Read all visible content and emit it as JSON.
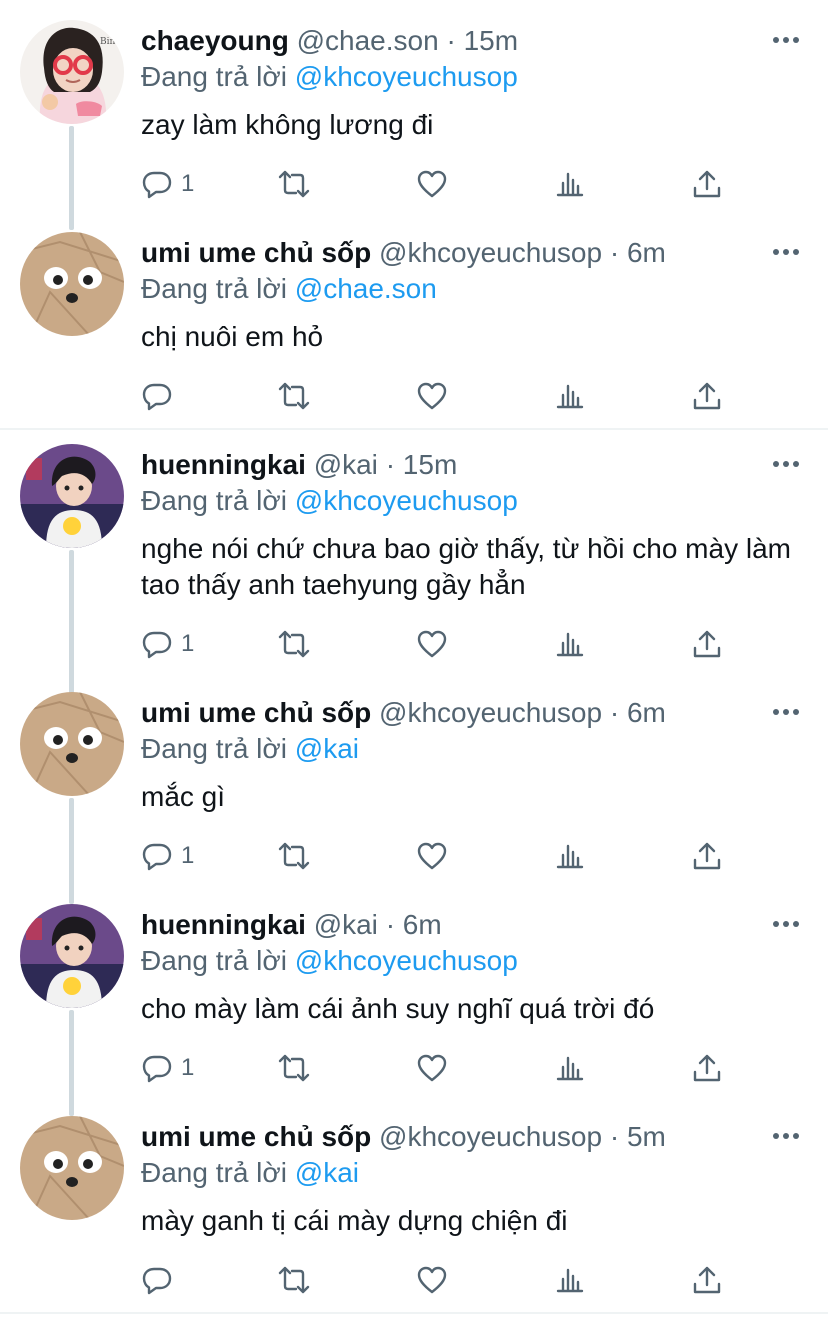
{
  "accent_color": "#1d9bf0",
  "reply_prefix": "Đang trả lời",
  "tweets": [
    {
      "name": "chaeyoung",
      "handle": "@chae.son",
      "time": "15m",
      "reply_to": "@khcoyeuchusop",
      "text": "zay làm không lương đi",
      "reply_count": "1",
      "avatar": "chaeyoung-avatar"
    },
    {
      "name": "umi ume chủ sốp",
      "handle": "@khcoyeuchusop",
      "time": "6m",
      "reply_to": "@chae.son",
      "text": "chị nuôi em hỏ",
      "reply_count": "",
      "avatar": "paper-bag-avatar"
    },
    {
      "name": "huenningkai",
      "handle": "@kai",
      "time": "15m",
      "reply_to": "@khcoyeuchusop",
      "text": "nghe nói chứ chưa bao giờ thấy, từ hồi cho mày làm tao thấy anh taehyung gầy hẳn",
      "reply_count": "1",
      "avatar": "huenningkai-avatar"
    },
    {
      "name": "umi ume chủ sốp",
      "handle": "@khcoyeuchusop",
      "time": "6m",
      "reply_to": "@kai",
      "text": "mắc gì",
      "reply_count": "1",
      "avatar": "paper-bag-avatar"
    },
    {
      "name": "huenningkai",
      "handle": "@kai",
      "time": "6m",
      "reply_to": "@khcoyeuchusop",
      "text": "cho mày làm cái ảnh suy nghĩ quá trời đó",
      "reply_count": "1",
      "avatar": "huenningkai-avatar"
    },
    {
      "name": "umi ume chủ sốp",
      "handle": "@khcoyeuchusop",
      "time": "5m",
      "reply_to": "@kai",
      "text": "mày ganh tị cái mày dựng chiện đi",
      "reply_count": "",
      "avatar": "paper-bag-avatar"
    }
  ]
}
